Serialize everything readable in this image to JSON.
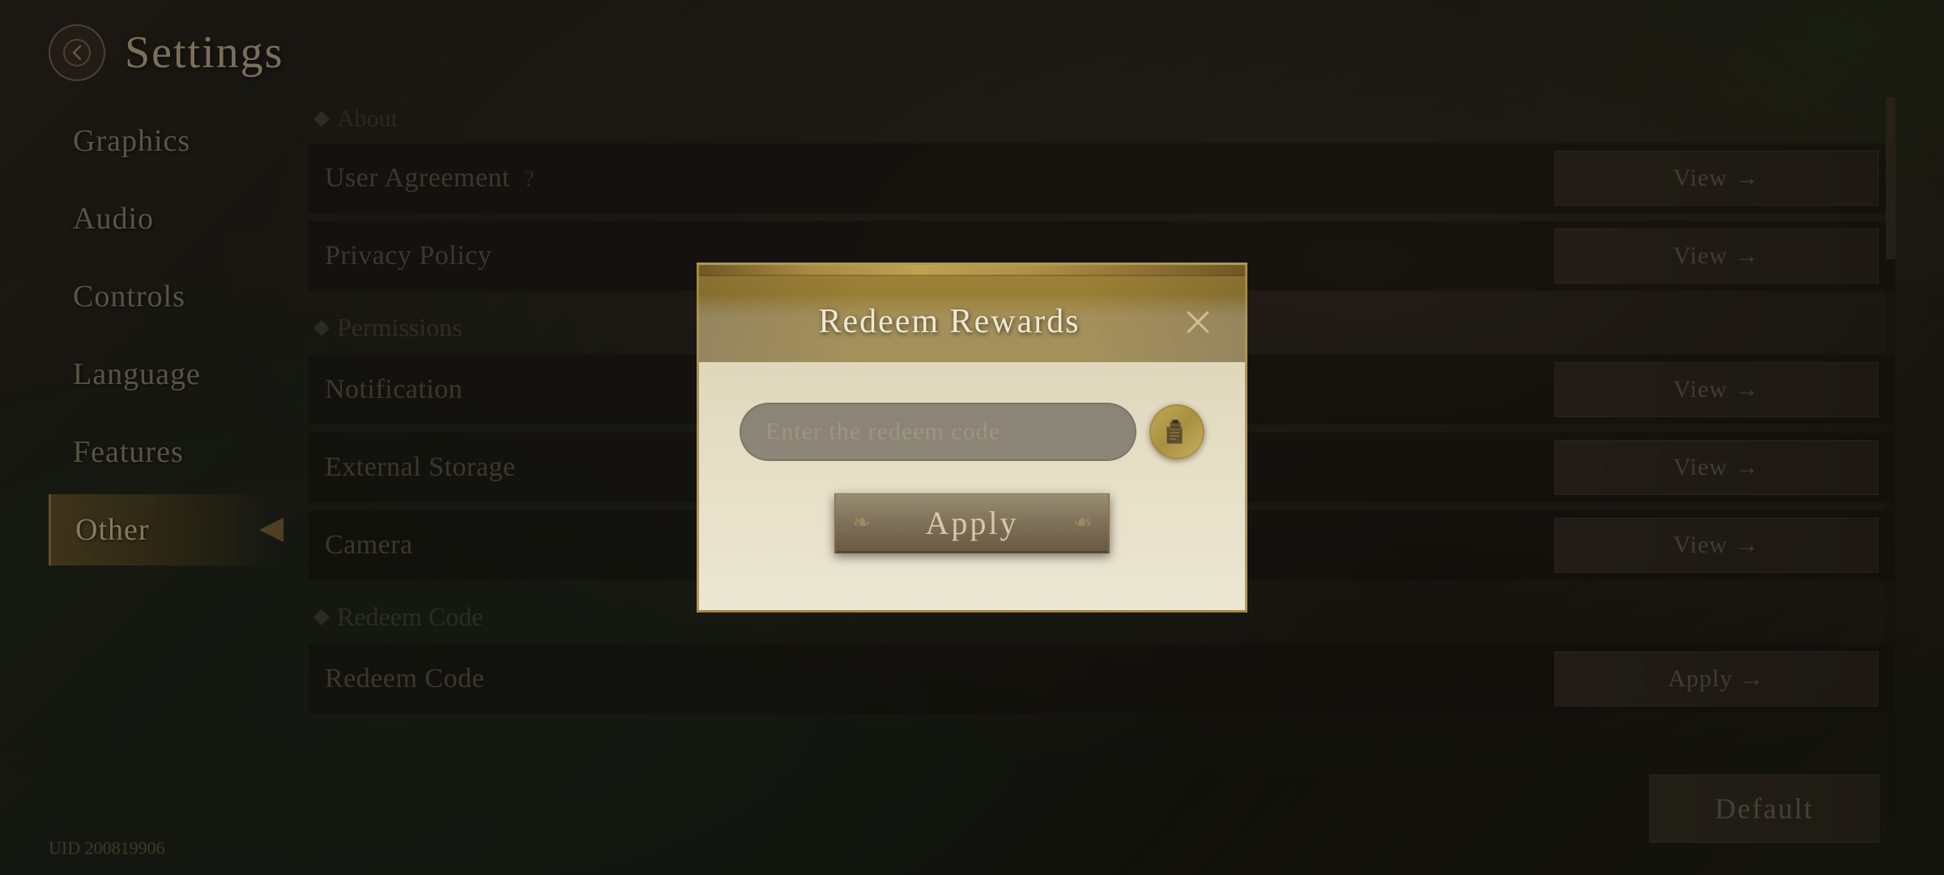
{
  "app": {
    "title": "Settings",
    "uid": "UID 200819906"
  },
  "sidebar": {
    "items": [
      {
        "id": "graphics",
        "label": "Graphics",
        "active": false
      },
      {
        "id": "audio",
        "label": "Audio",
        "active": false
      },
      {
        "id": "controls",
        "label": "Controls",
        "active": false
      },
      {
        "id": "language",
        "label": "Language",
        "active": false
      },
      {
        "id": "features",
        "label": "Features",
        "active": false
      },
      {
        "id": "other",
        "label": "Other",
        "active": true
      }
    ]
  },
  "main": {
    "sections": [
      {
        "type": "header",
        "label": "About"
      },
      {
        "type": "row",
        "label": "User Agreement",
        "has_question": true,
        "action": "View →"
      },
      {
        "type": "row",
        "label": "Privacy Policy",
        "has_question": false,
        "action": "View →"
      },
      {
        "type": "header",
        "label": "Permissions"
      },
      {
        "type": "row",
        "label": "Notification",
        "has_question": false,
        "action": "View →"
      },
      {
        "type": "row",
        "label": "External Storage",
        "has_question": false,
        "action": "View →"
      },
      {
        "type": "row",
        "label": "Camera",
        "has_question": false,
        "action": "View →"
      },
      {
        "type": "header",
        "label": "Redeem Code"
      },
      {
        "type": "row",
        "label": "Redeem Code",
        "has_question": false,
        "action": "Apply →"
      }
    ],
    "default_button_label": "Default"
  },
  "modal": {
    "title": "Redeem Rewards",
    "close_label": "×",
    "input_placeholder": "Enter the redeem code",
    "apply_button_label": "Apply",
    "paste_icon": "paste-icon"
  }
}
